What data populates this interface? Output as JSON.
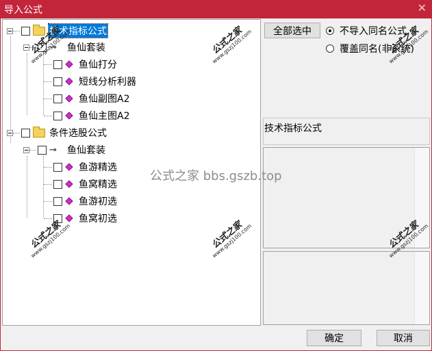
{
  "window": {
    "title": "导入公式",
    "close_glyph": "✕"
  },
  "tree": [
    {
      "label": "技术指标公式",
      "icon": "folder-icon",
      "selected": true,
      "children": [
        {
          "label": "鱼仙套装",
          "icon": "key-icon",
          "children": [
            {
              "label": "鱼仙打分",
              "icon": "formula-diamond-icon"
            },
            {
              "label": "短线分析利器",
              "icon": "formula-diamond-icon"
            },
            {
              "label": "鱼仙副图A2",
              "icon": "formula-diamond-icon"
            },
            {
              "label": "鱼仙主图A2",
              "icon": "formula-diamond-icon"
            }
          ]
        }
      ]
    },
    {
      "label": "条件选股公式",
      "icon": "folder-icon",
      "selected": false,
      "children": [
        {
          "label": "鱼仙套装",
          "icon": "key-icon",
          "children": [
            {
              "label": "鱼游精选",
              "icon": "formula-diamond-icon"
            },
            {
              "label": "鱼窝精选",
              "icon": "formula-diamond-icon"
            },
            {
              "label": "鱼游初选",
              "icon": "formula-diamond-icon"
            },
            {
              "label": "鱼窝初选",
              "icon": "formula-diamond-icon"
            }
          ]
        }
      ]
    }
  ],
  "options": {
    "select_all_label": "全部选中",
    "radio_skip_label": "不导入同名公式",
    "radio_skip_checked": true,
    "radio_overwrite_label": "覆盖同名(非系统)",
    "radio_overwrite_checked": false
  },
  "details": {
    "selected_name": "技术指标公式"
  },
  "buttons": {
    "ok_label": "确定",
    "cancel_label": "取消"
  },
  "watermark": {
    "text": "公式之家 bbs.gszb.top",
    "stamp_title": "公式之家",
    "stamp_url": "www.gszj100.com"
  }
}
